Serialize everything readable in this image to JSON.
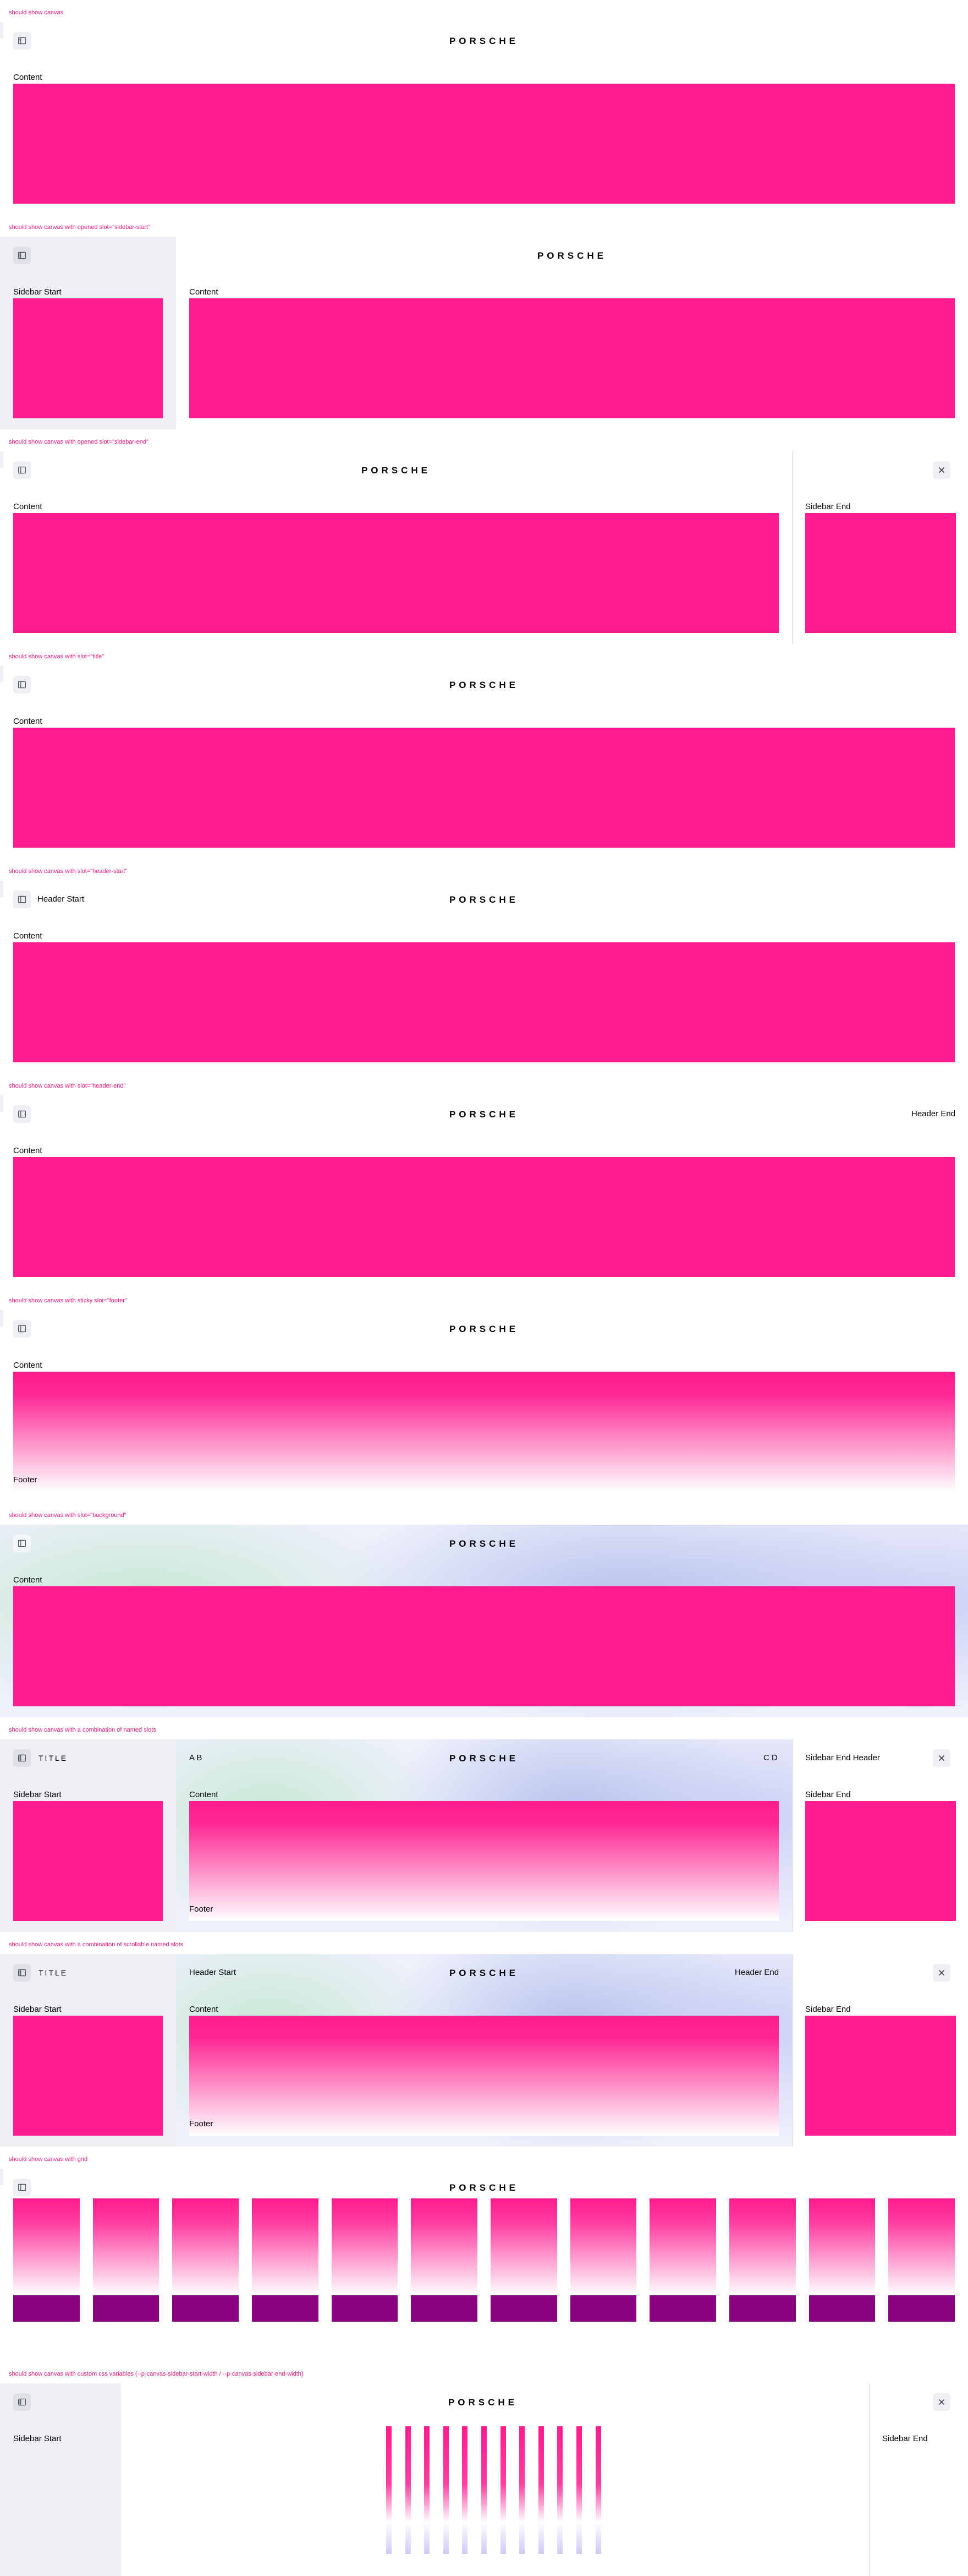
{
  "brand": "PORSCHE",
  "common": {
    "content": "Content",
    "footer": "Footer",
    "sidebar_start": "Sidebar Start",
    "sidebar_end": "Sidebar End",
    "header_start": "Header Start",
    "header_end": "Header End",
    "title": "TITLE",
    "sidebar_end_header": "Sidebar End Header",
    "a_b": "A B",
    "c_d": "C D"
  },
  "cases": [
    {
      "label": "should show canvas"
    },
    {
      "label": "should show canvas with opened slot=\"sidebar-start\""
    },
    {
      "label": "should show canvas with opened slot=\"sidebar-end\""
    },
    {
      "label": "should show canvas with slot=\"title\""
    },
    {
      "label": "should show canvas with slot=\"header-start\""
    },
    {
      "label": "should show canvas with slot=\"header-end\""
    },
    {
      "label": "should show canvas with sticky slot=\"footer\""
    },
    {
      "label": "should show canvas with slot=\"background\""
    },
    {
      "label": "should show canvas with a combination of named slots"
    },
    {
      "label": "should show canvas with a combination of scrollable named slots"
    },
    {
      "label": "should show canvas with grid"
    },
    {
      "label": "should show canvas with custom css variables (--p-canvas-sidebar-start-width / --p-canvas-sidebar-end-width)"
    }
  ],
  "colors": {
    "accent": "#ff1b8d",
    "label": "#e1187f",
    "footer_block": "#880282",
    "sidebar": "#eeeff2"
  },
  "icons": {
    "sidebar_toggle": "sidebar-toggle-icon",
    "close": "close-icon",
    "crest": "porsche-wordmark"
  }
}
